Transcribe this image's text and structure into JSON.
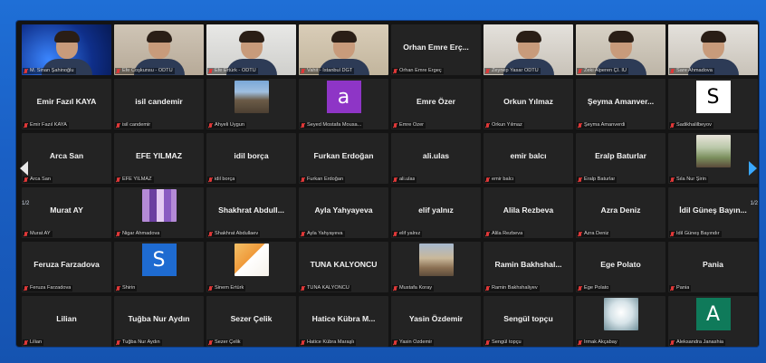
{
  "navigation": {
    "prev_page": "1/2",
    "next_page": "1/2"
  },
  "colors": {
    "mic_muted": "#e03838",
    "active_speaker": "#e6d24a",
    "accent": "#3aa8ff"
  },
  "tiles": [
    {
      "type": "video",
      "name": "",
      "label": "M. Sinan Şahinoğlu",
      "bg": "bg-blue"
    },
    {
      "type": "video",
      "name": "",
      "label": "Efe Coşkunsu - ODTÜ",
      "bg": "bg-room"
    },
    {
      "type": "video",
      "name": "",
      "label": "Efe Ertürk - ODTÜ",
      "bg": "bg-white"
    },
    {
      "type": "video",
      "name": "",
      "label": "Vahit - İstanbul DGT",
      "bg": "bg-beige"
    },
    {
      "type": "name",
      "name": "Orhan Emre Erç...",
      "label": "Orhan Emre Ergeç"
    },
    {
      "type": "video",
      "name": "",
      "label": "Zeynep Yasar ODTÜ",
      "bg": "bg-light"
    },
    {
      "type": "video",
      "name": "",
      "label": "Zeki Alperen Çİ. İÜ",
      "bg": "bg-wall"
    },
    {
      "type": "video",
      "name": "",
      "label": "Sare Ahmadova",
      "bg": "bg-light",
      "active": true
    },
    {
      "type": "name",
      "name": "Emir Fazıl KAYA",
      "label": "Emir Fazıl KAYA"
    },
    {
      "type": "name",
      "name": "isil candemir",
      "label": "isil candemir"
    },
    {
      "type": "pic",
      "name": "",
      "label": "Ahyeli Uygun",
      "pic": "street"
    },
    {
      "type": "letter",
      "name": "",
      "label": "Seyed Mostafa Mousa...",
      "letter": "a",
      "color": "#8e35c6"
    },
    {
      "type": "name",
      "name": "Emre Özer",
      "label": "Emre Özer"
    },
    {
      "type": "name",
      "name": "Orkun Yılmaz",
      "label": "Orkun Yılmaz"
    },
    {
      "type": "name",
      "name": "Şeyma Amanver...",
      "label": "Şeyma Amanverdi"
    },
    {
      "type": "letter",
      "name": "",
      "label": "Sadikhalilbeyov",
      "letter": "S",
      "color": "#ffffff",
      "textColor": "#000000"
    },
    {
      "type": "name",
      "name": "Arca San",
      "label": "Arca San"
    },
    {
      "type": "name",
      "name": "EFE YILMAZ",
      "label": "EFE YILMAZ"
    },
    {
      "type": "name",
      "name": "idil borça",
      "label": "idil borça"
    },
    {
      "type": "name",
      "name": "Furkan Erdoğan",
      "label": "Furkan Erdoğan"
    },
    {
      "type": "name",
      "name": "ali.ulas",
      "label": "ali.ulas"
    },
    {
      "type": "name",
      "name": "emir balcı",
      "label": "emir balcı"
    },
    {
      "type": "name",
      "name": "Eralp Baturlar",
      "label": "Eralp Baturlar"
    },
    {
      "type": "pic",
      "name": "",
      "label": "Sıla Nur Şirin",
      "pic": "garden"
    },
    {
      "type": "name",
      "name": "Murat AY",
      "label": "Murat AY"
    },
    {
      "type": "pic",
      "name": "",
      "label": "Nigar Ahmadova",
      "pic": "mosaic"
    },
    {
      "type": "name",
      "name": "Shakhrat Abdull...",
      "label": "Shakhrat Abdullaev"
    },
    {
      "type": "name",
      "name": "Ayla Yahyayeva",
      "label": "Ayla Yahyayeva"
    },
    {
      "type": "name",
      "name": "elif yalnız",
      "label": "elif yalnız"
    },
    {
      "type": "name",
      "name": "Alila Rezbeva",
      "label": "Alila Rezbeva"
    },
    {
      "type": "name",
      "name": "Azra Deniz",
      "label": "Azra Deniz"
    },
    {
      "type": "name",
      "name": "İdil Güneş Bayın...",
      "label": "İdil Güneş Bayındır"
    },
    {
      "type": "name",
      "name": "Feruza Farzadova",
      "label": "Feruza Farzadova"
    },
    {
      "type": "letter",
      "name": "",
      "label": "Shirin",
      "letter": "S",
      "color": "#1e6bd1"
    },
    {
      "type": "pic",
      "name": "",
      "label": "Sinem Ertürk",
      "pic": "sun"
    },
    {
      "type": "name",
      "name": "TUNA KALYONCU",
      "label": "TUNA KALYONCU"
    },
    {
      "type": "pic",
      "name": "",
      "label": "Mustafa Koray",
      "pic": "crowd"
    },
    {
      "type": "name",
      "name": "Ramin Bakhshal...",
      "label": "Ramin Bakhshaliyev"
    },
    {
      "type": "name",
      "name": "Ege Polato",
      "label": "Ege Polato"
    },
    {
      "type": "name",
      "name": "Pania",
      "label": "Pania"
    },
    {
      "type": "name",
      "name": "Lilian",
      "label": "Lilian"
    },
    {
      "type": "name",
      "name": "Tuğba Nur Aydın",
      "label": "Tuğba Nur Aydın"
    },
    {
      "type": "name",
      "name": "Sezer Çelik",
      "label": "Sezer Çelik"
    },
    {
      "type": "name",
      "name": "Hatice Kübra M...",
      "label": "Hatice Kübra Maraşlı"
    },
    {
      "type": "name",
      "name": "Yasin Özdemir",
      "label": "Yasin Özdemir"
    },
    {
      "type": "name",
      "name": "Sengül topçu",
      "label": "Sengül topçu"
    },
    {
      "type": "pic",
      "name": "",
      "label": "Irmak Akçabay",
      "pic": "sketch"
    },
    {
      "type": "letter",
      "name": "",
      "label": "Aleksandra Janashia",
      "letter": "A",
      "color": "#0f7a5a"
    }
  ]
}
